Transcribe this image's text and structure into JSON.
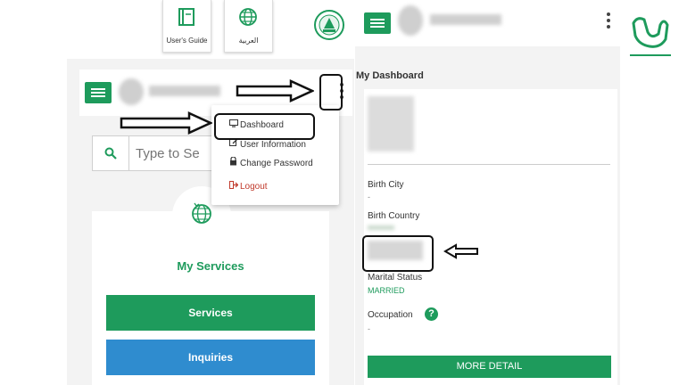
{
  "left": {
    "tiles": [
      {
        "label": "User's Guide",
        "icon": "book-icon"
      },
      {
        "label": "العربية",
        "icon": "globe-icon"
      }
    ],
    "search": {
      "placeholder": "Type to Se"
    },
    "services": {
      "title": "My Services",
      "buttons": [
        {
          "label": "Services",
          "color": "#1e9b5c"
        },
        {
          "label": "Inquiries",
          "color": "#2f8ccf"
        }
      ]
    },
    "menu": [
      {
        "label": "Dashboard",
        "icon": "monitor-icon"
      },
      {
        "label": "User Information",
        "icon": "edit-icon"
      },
      {
        "label": "Change Password",
        "icon": "lock-icon"
      },
      {
        "label": "Logout",
        "icon": "logout-icon"
      }
    ]
  },
  "right": {
    "section_title": "My Dashboard",
    "fields": {
      "birth_city_label": "Birth City",
      "birth_city_value": "-",
      "birth_country_label": "Birth Country",
      "marital_label": "Marital Status",
      "marital_value": "MARRIED",
      "occupation_label": "Occupation",
      "occupation_value": "-"
    },
    "more_detail": "MORE DETAIL"
  },
  "colors": {
    "green": "#1e9b5c",
    "blue": "#2f8ccf",
    "logout": "#c0392b"
  }
}
